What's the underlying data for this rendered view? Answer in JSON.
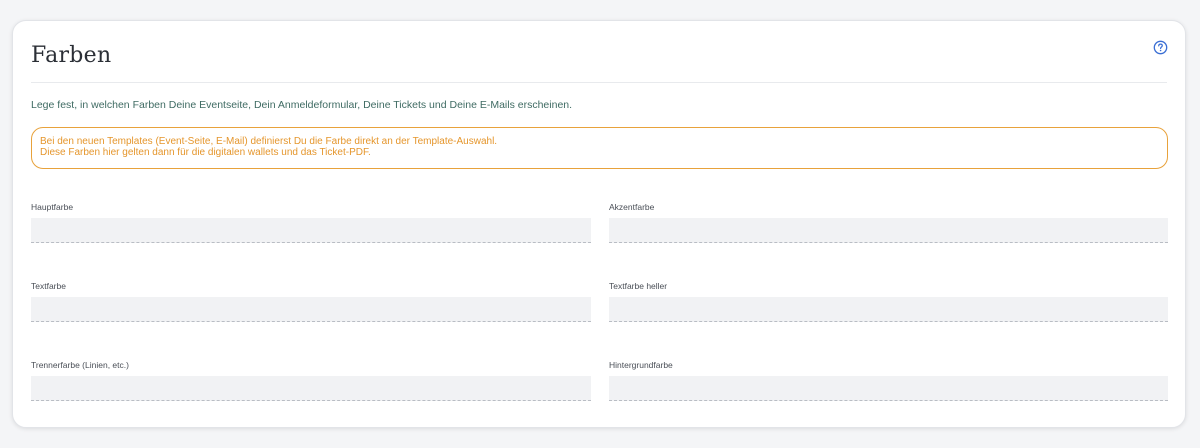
{
  "section": {
    "title": "Farben",
    "help_icon": "question-circle-icon",
    "accent_color": "#3b6fd4"
  },
  "intro": {
    "text": "Lege fest, in welchen Farben Deine Eventseite, Dein Anmeldeformular, Deine Tickets und Deine E-Mails erscheinen."
  },
  "notice": {
    "line1": "Bei den neuen Templates (Event-Seite, E-Mail) definierst Du die Farbe direkt an der Template-Auswahl.",
    "line2": "Diese Farben hier gelten dann für die digitalen wallets und das Ticket-PDF.",
    "color": "#e5962c"
  },
  "fields": {
    "hauptfarbe": {
      "label": "Hauptfarbe",
      "value": ""
    },
    "akzentfarbe": {
      "label": "Akzentfarbe",
      "value": ""
    },
    "textfarbe": {
      "label": "Textfarbe",
      "value": ""
    },
    "textfarbe_heller": {
      "label": "Textfarbe heller",
      "value": ""
    },
    "trennerfarbe": {
      "label": "Trennerfarbe (Linien, etc.)",
      "value": ""
    },
    "hintergrundfarbe": {
      "label": "Hintergrundfarbe",
      "value": ""
    }
  }
}
